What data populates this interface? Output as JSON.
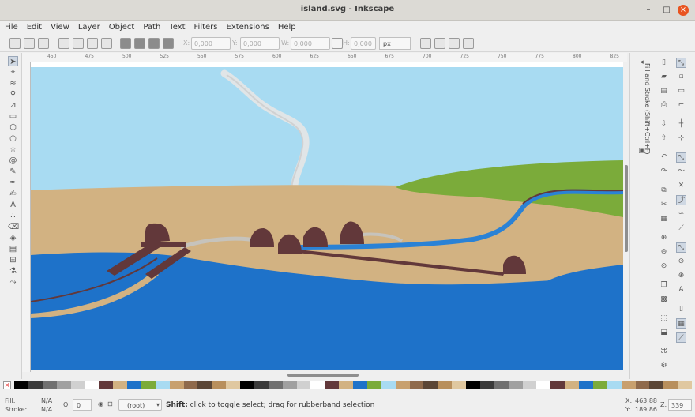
{
  "window": {
    "title": "island.svg - Inkscape"
  },
  "menu": [
    "File",
    "Edit",
    "View",
    "Layer",
    "Object",
    "Path",
    "Text",
    "Filters",
    "Extensions",
    "Help"
  ],
  "toolbar": {
    "x_label": "X:",
    "x_value": "0,000",
    "y_label": "Y:",
    "y_value": "0,000",
    "w_label": "W:",
    "w_value": "0,000",
    "h_label": "H:",
    "h_value": "0,000",
    "unit": "px"
  },
  "ruler_top": [
    "450",
    "475",
    "500",
    "525",
    "550",
    "575",
    "600",
    "625",
    "650",
    "675",
    "700",
    "725",
    "750",
    "775",
    "800",
    "825"
  ],
  "dock": {
    "panel_title": "Fill and Stroke (Shift+Ctrl+F)"
  },
  "status": {
    "fill_label": "Fill:",
    "fill_value": "N/A",
    "stroke_label": "Stroke:",
    "stroke_value": "N/A",
    "opacity_label": "O:",
    "opacity_value": "0",
    "layer": "(root)",
    "message_key": "Shift:",
    "message_rest": " click to toggle select; drag for rubberband selection",
    "x_label": "X:",
    "x_value": "463,88",
    "y_label": "Y:",
    "y_value": "189,86",
    "zoom_label": "Z:",
    "zoom_value": "339"
  },
  "colors": {
    "sky": "#a8dbf2",
    "sand": "#d2b282",
    "water": "#1e72c9",
    "grass": "#7bab3a",
    "hut": "#62383a",
    "smoke": "#dcdcdc",
    "river": "#2a82d6",
    "path": "#c6c3bc"
  },
  "palette": [
    "#000000",
    "#3a3a3a",
    "#707070",
    "#a0a0a0",
    "#d0d0d0",
    "#ffffff",
    "#62383a",
    "#d2b282",
    "#1e72c9",
    "#7bab3a",
    "#a8dbf2",
    "#c8a06e",
    "#8f6a4c",
    "#5b4636",
    "#b88f5c",
    "#e0c8a0"
  ]
}
